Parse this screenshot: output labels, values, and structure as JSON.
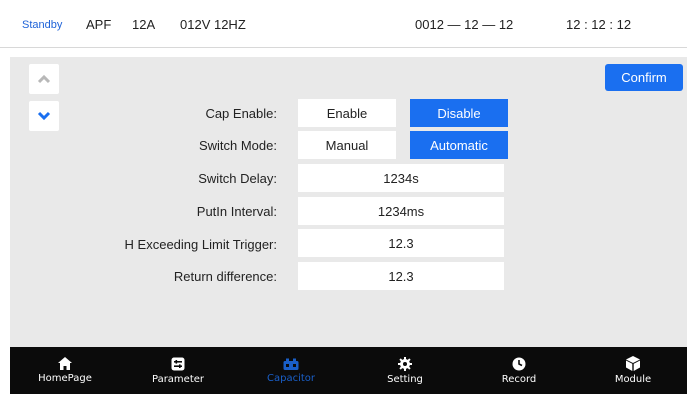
{
  "status": {
    "mode": "Standby",
    "device": "APF",
    "current": "12A",
    "voltage_freq": "012V 12HZ",
    "date": "0012 — 12 — 12",
    "time": "12 : 12 : 12"
  },
  "actions": {
    "confirm_label": "Confirm"
  },
  "settings": {
    "cap_enable": {
      "label": "Cap Enable:",
      "options": [
        "Enable",
        "Disable"
      ],
      "selected": "Disable"
    },
    "switch_mode": {
      "label": "Switch Mode:",
      "options": [
        "Manual",
        "Automatic"
      ],
      "selected": "Automatic"
    },
    "switch_delay": {
      "label": "Switch Delay:",
      "value": "1234s"
    },
    "putin_interval": {
      "label": "PutIn Interval:",
      "value": "1234ms"
    },
    "h_exceeding": {
      "label": "H Exceeding Limit Trigger:",
      "value": "12.3"
    },
    "return_diff": {
      "label": "Return difference:",
      "value": "12.3"
    }
  },
  "nav": {
    "items": [
      {
        "label": "HomePage",
        "icon": "home-icon"
      },
      {
        "label": "Parameter",
        "icon": "parameter-icon"
      },
      {
        "label": "Capacitor",
        "icon": "capacitor-icon"
      },
      {
        "label": "Setting",
        "icon": "gear-icon"
      },
      {
        "label": "Record",
        "icon": "clock-icon"
      },
      {
        "label": "Module",
        "icon": "module-icon"
      }
    ],
    "active": "Capacitor"
  },
  "colors": {
    "accent": "#1a6ff0",
    "panel_bg": "#e9e9e9",
    "nav_bg": "#0b0b0b",
    "active_tab": "#1a5fc8"
  }
}
